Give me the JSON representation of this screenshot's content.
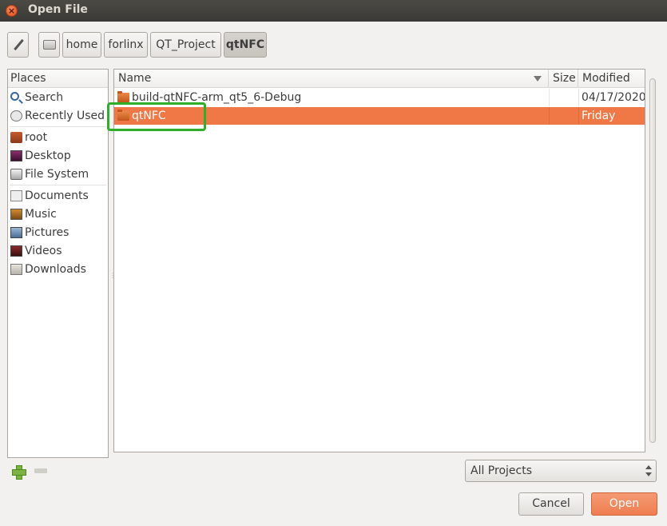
{
  "window": {
    "title": "Open File"
  },
  "pathbar": {
    "segments": [
      {
        "label": "home"
      },
      {
        "label": "forlinx"
      },
      {
        "label": "QT_Project"
      },
      {
        "label": "qtNFC"
      }
    ]
  },
  "places": {
    "header": "Places",
    "items": [
      {
        "label": "Search",
        "icon": "search-icon"
      },
      {
        "label": "Recently Used",
        "icon": "recent-icon"
      },
      {
        "label": "root",
        "icon": "home-folder-icon"
      },
      {
        "label": "Desktop",
        "icon": "desktop-icon"
      },
      {
        "label": "File System",
        "icon": "filesystem-icon"
      },
      {
        "label": "Documents",
        "icon": "documents-icon"
      },
      {
        "label": "Music",
        "icon": "music-icon"
      },
      {
        "label": "Pictures",
        "icon": "pictures-icon"
      },
      {
        "label": "Videos",
        "icon": "videos-icon"
      },
      {
        "label": "Downloads",
        "icon": "downloads-icon"
      }
    ]
  },
  "files": {
    "columns": {
      "name": "Name",
      "size": "Size",
      "modified": "Modified"
    },
    "rows": [
      {
        "name": "build-qtNFC-arm_qt5_6-Debug",
        "size": "",
        "modified": "04/17/2020",
        "selected": false
      },
      {
        "name": "qtNFC",
        "size": "",
        "modified": "Friday",
        "selected": true
      }
    ]
  },
  "filter": {
    "value": "All Projects"
  },
  "buttons": {
    "cancel": "Cancel",
    "open": "Open"
  },
  "colors": {
    "selection": "#f07746",
    "highlight_box": "#2fae2a",
    "open_button": "#ef7d50"
  }
}
